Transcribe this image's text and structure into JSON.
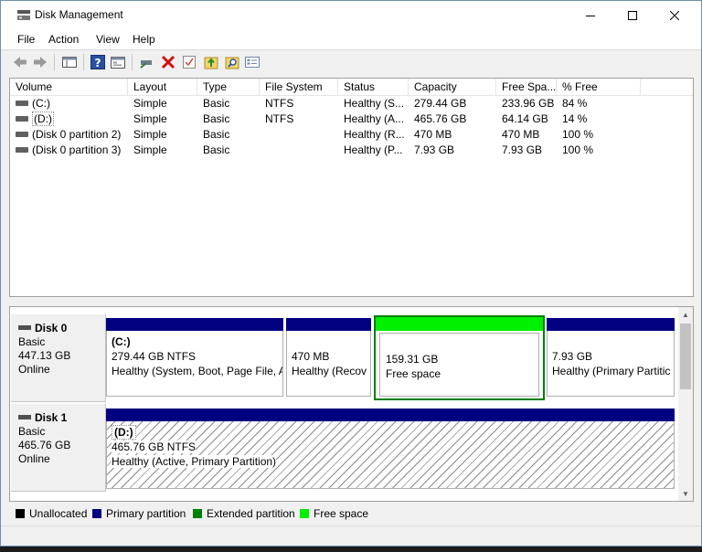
{
  "window": {
    "title": "Disk Management"
  },
  "menu": [
    "File",
    "Action",
    "View",
    "Help"
  ],
  "toolbar": {
    "icons": [
      "back-arrow-icon",
      "forward-arrow-icon",
      "console-tree-icon",
      "help-icon",
      "properties-icon",
      "connect-icon",
      "delete-icon",
      "check-icon",
      "import-icon",
      "search-icon",
      "details-icon"
    ]
  },
  "volumes": {
    "columns": [
      "Volume",
      "Layout",
      "Type",
      "File System",
      "Status",
      "Capacity",
      "Free Spa...",
      "% Free"
    ],
    "rows": [
      {
        "volume": "(C:)",
        "layout": "Simple",
        "type": "Basic",
        "fs": "NTFS",
        "status": "Healthy (S...",
        "capacity": "279.44 GB",
        "free": "233.96 GB",
        "pct": "84 %"
      },
      {
        "volume": "(D:)",
        "layout": "Simple",
        "type": "Basic",
        "fs": "NTFS",
        "status": "Healthy (A...",
        "capacity": "465.76 GB",
        "free": "64.14 GB",
        "pct": "14 %"
      },
      {
        "volume": "(Disk 0 partition 2)",
        "layout": "Simple",
        "type": "Basic",
        "fs": "",
        "status": "Healthy (R...",
        "capacity": "470 MB",
        "free": "470 MB",
        "pct": "100 %"
      },
      {
        "volume": "(Disk 0 partition 3)",
        "layout": "Simple",
        "type": "Basic",
        "fs": "",
        "status": "Healthy (P...",
        "capacity": "7.93 GB",
        "free": "7.93 GB",
        "pct": "100 %"
      }
    ]
  },
  "disks": [
    {
      "name": "Disk 0",
      "type": "Basic",
      "size": "447.13 GB",
      "state": "Online",
      "partitions": [
        {
          "name": "(C:)",
          "size": "279.44 GB NTFS",
          "status": "Healthy (System, Boot, Page File, A"
        },
        {
          "name": "",
          "size": "470 MB",
          "status": "Healthy (Recov"
        },
        {
          "name": "",
          "size": "159.31 GB",
          "status": "Free space"
        },
        {
          "name": "",
          "size": "7.93 GB",
          "status": "Healthy (Primary Partitic"
        }
      ]
    },
    {
      "name": "Disk 1",
      "type": "Basic",
      "size": "465.76 GB",
      "state": "Online",
      "partitions": [
        {
          "name": "(D:)",
          "size": "465.76 GB NTFS",
          "status": "Healthy (Active, Primary Partition)"
        }
      ]
    }
  ],
  "legend": [
    {
      "label": "Unallocated",
      "color": "#000000"
    },
    {
      "label": "Primary partition",
      "color": "#000080"
    },
    {
      "label": "Extended partition",
      "color": "#008000"
    },
    {
      "label": "Free space",
      "color": "#00f000"
    }
  ]
}
